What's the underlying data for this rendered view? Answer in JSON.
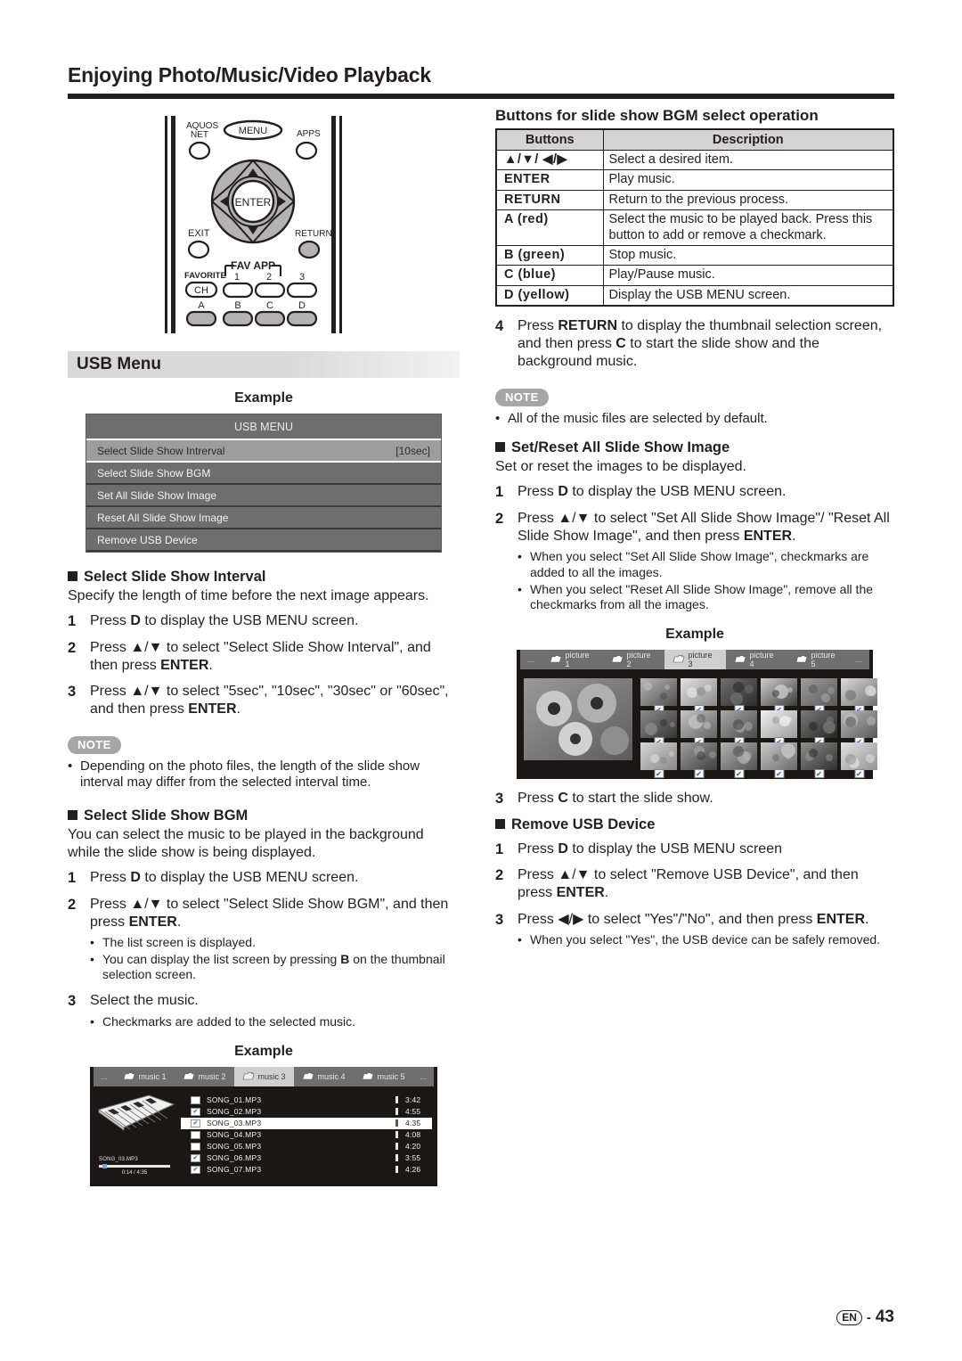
{
  "header": {
    "title": "Enjoying Photo/Music/Video Playback"
  },
  "remote": {
    "labels": {
      "aquos_net_1": "AQUOS",
      "aquos_net_2": "NET",
      "menu": "MENU",
      "apps": "APPS",
      "enter": "ENTER",
      "exit": "EXIT",
      "return": "RETURN",
      "favorite": "FAVORITE",
      "ch": "CH",
      "fav_app": "FAV APP",
      "fav1": "1",
      "fav2": "2",
      "fav3": "3",
      "a": "A",
      "b": "B",
      "c": "C",
      "d": "D"
    }
  },
  "usb_menu_band": {
    "title": "USB Menu"
  },
  "example_caption": "Example",
  "usb_screen": {
    "title": "USB MENU",
    "rows": [
      {
        "label": "Select Slide Show Intrerval",
        "value": "[10sec]",
        "selected": true
      },
      {
        "label": "Select Slide Show BGM",
        "value": "",
        "selected": false
      },
      {
        "label": "Set All Slide Show Image",
        "value": "",
        "selected": false
      },
      {
        "label": "Reset All Slide Show Image",
        "value": "",
        "selected": false
      },
      {
        "label": "Remove USB Device",
        "value": "",
        "selected": false
      }
    ]
  },
  "interval_section": {
    "heading": "Select Slide Show Interval",
    "intro": "Specify the length of time before the next image appears.",
    "steps": [
      {
        "num": "1",
        "pre": "Press ",
        "bold": "D",
        "post": " to display the USB MENU screen."
      },
      {
        "num": "2",
        "pre": "Press ▲/▼ to select \"Select Slide Show Interval\", and then press ",
        "bold": "ENTER",
        "post": "."
      },
      {
        "num": "3",
        "pre": "Press ▲/▼ to select \"5sec\", \"10sec\", \"30sec\" or \"60sec\", and then press ",
        "bold": "ENTER",
        "post": "."
      }
    ],
    "note_badge": "NOTE",
    "notes": [
      "Depending on the photo files, the length of the slide show interval may differ from the selected interval time."
    ]
  },
  "bgm_section": {
    "heading": "Select Slide Show BGM",
    "intro": "You can select the music to be played in the background while the slide show is being displayed.",
    "steps": [
      {
        "num": "1",
        "pre": "Press ",
        "bold": "D",
        "post": " to display the USB MENU screen.",
        "subs": []
      },
      {
        "num": "2",
        "pre": "Press ▲/▼ to  select \"Select Slide Show BGM\", and then press ",
        "bold": "ENTER",
        "post": ".",
        "subs": [
          {
            "pre": "The list screen is displayed.",
            "bold": "",
            "post": ""
          },
          {
            "pre": "You can display the list screen by pressing ",
            "bold": "B",
            "post": " on the thumbnail selection screen."
          }
        ]
      },
      {
        "num": "3",
        "pre": "Select the music.",
        "bold": "",
        "post": "",
        "subs": [
          {
            "pre": "Checkmarks are added to the selected music.",
            "bold": "",
            "post": ""
          }
        ]
      }
    ]
  },
  "music_screen": {
    "folders": {
      "left_ellipsis": "...",
      "right_ellipsis": "...",
      "tabs": [
        {
          "label": "music 1",
          "selected": false
        },
        {
          "label": "music 2",
          "selected": false
        },
        {
          "label": "music 3",
          "selected": true
        },
        {
          "label": "music 4",
          "selected": false
        },
        {
          "label": "music 5",
          "selected": false
        }
      ]
    },
    "tracks": [
      {
        "name": "SONG_01.MP3",
        "duration": "3:42",
        "checked": false,
        "playing": false
      },
      {
        "name": "SONG_02.MP3",
        "duration": "4:55",
        "checked": true,
        "playing": false
      },
      {
        "name": "SONG_03.MP3",
        "duration": "4:35",
        "checked": true,
        "playing": true
      },
      {
        "name": "SONG_04.MP3",
        "duration": "4:08",
        "checked": false,
        "playing": false
      },
      {
        "name": "SONG_05.MP3",
        "duration": "4:20",
        "checked": false,
        "playing": false
      },
      {
        "name": "SONG_06.MP3",
        "duration": "3:55",
        "checked": true,
        "playing": false
      },
      {
        "name": "SONG_07.MP3",
        "duration": "4:26",
        "checked": true,
        "playing": false
      }
    ],
    "now_playing": {
      "title": "SONG_03.MP3",
      "time": "0:14 / 4:35"
    }
  },
  "buttons_table": {
    "title": "Buttons for slide show BGM select operation",
    "headers": [
      "Buttons",
      "Description"
    ],
    "rows": [
      {
        "key": "▲/▼/ ◀/▶",
        "desc": "Select a desired item."
      },
      {
        "key": "ENTER",
        "desc": "Play music."
      },
      {
        "key": "RETURN",
        "desc": "Return to the previous process."
      },
      {
        "key": "A (red)",
        "desc": "Select the music to be played back. Press this button to add or remove a checkmark."
      },
      {
        "key": "B (green)",
        "desc": "Stop music."
      },
      {
        "key": "C (blue)",
        "desc": "Play/Pause music."
      },
      {
        "key": "D (yellow)",
        "desc": "Display the USB MENU screen."
      }
    ]
  },
  "right_step4": {
    "num": "4",
    "pre_a": "Press ",
    "bold_a": "RETURN",
    "mid": " to display the thumbnail selection screen, and then press ",
    "bold_b": "C",
    "post": " to start the slide show and the background music."
  },
  "right_note": {
    "badge": "NOTE",
    "items": [
      "All of the music files are selected by default."
    ]
  },
  "setreset_section": {
    "heading": "Set/Reset All Slide Show Image",
    "intro": "Set or reset the images to be displayed.",
    "steps": [
      {
        "num": "1",
        "pre": "Press ",
        "bold": "D",
        "post": " to display the USB MENU screen.",
        "subs": []
      },
      {
        "num": "2",
        "pre": "Press ▲/▼ to select \"Set All Slide Show Image\"/ \"Reset All Slide Show Image\", and then press ",
        "bold": "ENTER",
        "post": ".",
        "subs": [
          {
            "pre": "When you select \"Set All Slide Show Image\", checkmarks are added to all the images.",
            "bold": "",
            "post": ""
          },
          {
            "pre": "When you select \"Reset All Slide Show Image\", remove all the checkmarks from all the images.",
            "bold": "",
            "post": ""
          }
        ]
      }
    ],
    "step3": {
      "num": "3",
      "pre": "Press ",
      "bold": "C",
      "post": " to start the slide show."
    }
  },
  "picture_screen": {
    "folders": {
      "left_ellipsis": "...",
      "right_ellipsis": "...",
      "tabs": [
        {
          "label": "picture 1",
          "selected": false
        },
        {
          "label": "picture 2",
          "selected": false
        },
        {
          "label": "picture 3",
          "selected": true
        },
        {
          "label": "picture 4",
          "selected": false
        },
        {
          "label": "picture 5",
          "selected": false
        }
      ]
    },
    "thumb_count": 18,
    "checkmark": "✔"
  },
  "remove_section": {
    "heading": "Remove USB Device",
    "steps": [
      {
        "num": "1",
        "pre": "Press ",
        "bold": "D",
        "post": " to display the USB MENU screen",
        "subs": []
      },
      {
        "num": "2",
        "pre": "Press ▲/▼ to select \"Remove USB Device\", and then press ",
        "bold": "ENTER",
        "post": ".",
        "subs": []
      },
      {
        "num": "3",
        "pre": "Press ◀/▶ to select \"Yes\"/\"No\", and then press ",
        "bold": "ENTER",
        "post": ".",
        "subs": [
          {
            "pre": "When you select \"Yes\", the USB device can be safely removed.",
            "bold": "",
            "post": ""
          }
        ]
      }
    ]
  },
  "footer": {
    "lang": "EN",
    "dash": "-",
    "page": "43"
  }
}
